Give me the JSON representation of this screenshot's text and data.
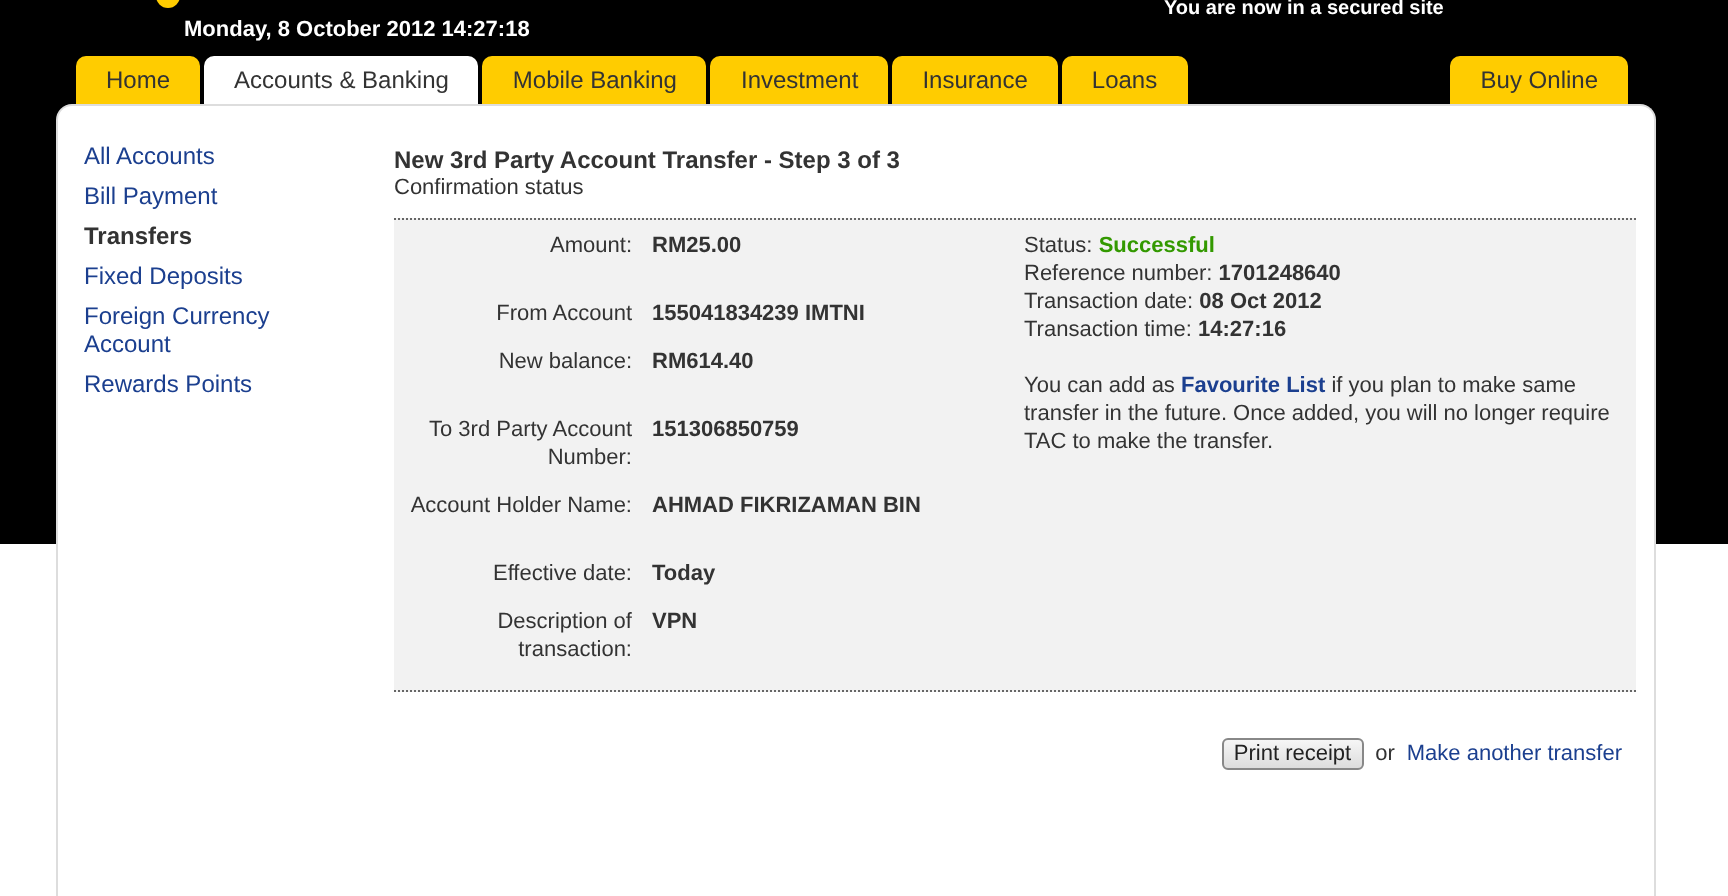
{
  "header": {
    "secure_notice": "You are now in a secured site",
    "datetime": "Monday, 8 October 2012 14:27:18"
  },
  "tabs": [
    {
      "label": "Home",
      "selected": false
    },
    {
      "label": "Accounts & Banking",
      "selected": true
    },
    {
      "label": "Mobile Banking",
      "selected": false
    },
    {
      "label": "Investment",
      "selected": false
    },
    {
      "label": "Insurance",
      "selected": false
    },
    {
      "label": "Loans",
      "selected": false
    }
  ],
  "buy_online": "Buy Online",
  "sidebar": {
    "items": [
      {
        "label": "All Accounts",
        "selected": false
      },
      {
        "label": "Bill Payment",
        "selected": false
      },
      {
        "label": "Transfers",
        "selected": true
      },
      {
        "label": "Fixed Deposits",
        "selected": false
      },
      {
        "label": "Foreign Currency Account",
        "selected": false
      },
      {
        "label": "Rewards Points",
        "selected": false
      }
    ]
  },
  "page": {
    "title": "New 3rd Party Account Transfer - Step 3 of 3",
    "subtitle": "Confirmation status"
  },
  "details": [
    {
      "label": "Amount:",
      "value": "RM25.00"
    },
    {
      "label": "From Account",
      "value": "155041834239 IMTNI"
    },
    {
      "label": "New balance:",
      "value": "RM614.40"
    },
    {
      "label": "To 3rd Party Account Number:",
      "value": "151306850759"
    },
    {
      "label": "Account Holder Name:",
      "value": "AHMAD FIKRIZAMAN BIN"
    },
    {
      "label": "Effective date:",
      "value": "Today"
    },
    {
      "label": "Description of transaction:",
      "value": "VPN"
    }
  ],
  "status": [
    {
      "label": "Status:",
      "value": "Successful",
      "color": "#339900"
    },
    {
      "label": "Reference number:",
      "value": "1701248640",
      "color": "#333333"
    },
    {
      "label": "Transaction date:",
      "value": "08 Oct 2012",
      "color": "#333333"
    },
    {
      "label": "Transaction time:",
      "value": "14:27:16",
      "color": "#333333"
    }
  ],
  "note": {
    "before": "You can add as",
    "link": "Favourite List",
    "after": "if you plan to make same transfer in the future. Once added, you will no longer require TAC to make the transfer."
  },
  "actions": {
    "button": "Print receipt",
    "separator": "or",
    "link": "Make another transfer"
  }
}
